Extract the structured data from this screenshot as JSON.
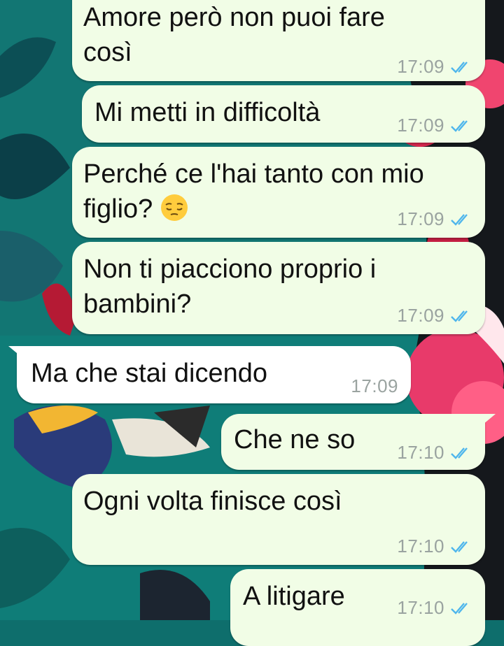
{
  "colors": {
    "outgoing_bubble": "#f1fde6",
    "incoming_bubble": "#ffffff",
    "read_tick": "#4fb6ec",
    "timestamp": "#9aa3a0"
  },
  "messages": [
    {
      "direction": "outgoing",
      "text": "Amore però non puoi fare\ncosì",
      "time": "17:09",
      "status": "read-double-check-icon"
    },
    {
      "direction": "outgoing",
      "text": "Mi metti in difficoltà",
      "time": "17:09",
      "status": "read-double-check-icon"
    },
    {
      "direction": "outgoing",
      "text": "Perché ce l'hai tanto con mio\nfiglio?",
      "emoji": "pensive-face-emoji",
      "time": "17:09",
      "status": "read-double-check-icon"
    },
    {
      "direction": "outgoing",
      "text": "Non ti piacciono proprio i\nbambini?",
      "time": "17:09",
      "status": "read-double-check-icon"
    },
    {
      "direction": "incoming",
      "text": "Ma che stai dicendo",
      "time": "17:09"
    },
    {
      "direction": "outgoing",
      "text": "Che ne so",
      "time": "17:10",
      "status": "read-double-check-icon"
    },
    {
      "direction": "outgoing",
      "text": "Ogni volta finisce così",
      "time": "17:10",
      "status": "read-double-check-icon"
    },
    {
      "direction": "outgoing",
      "text": "A litigare",
      "time": "17:10",
      "status": "read-double-check-icon"
    }
  ]
}
